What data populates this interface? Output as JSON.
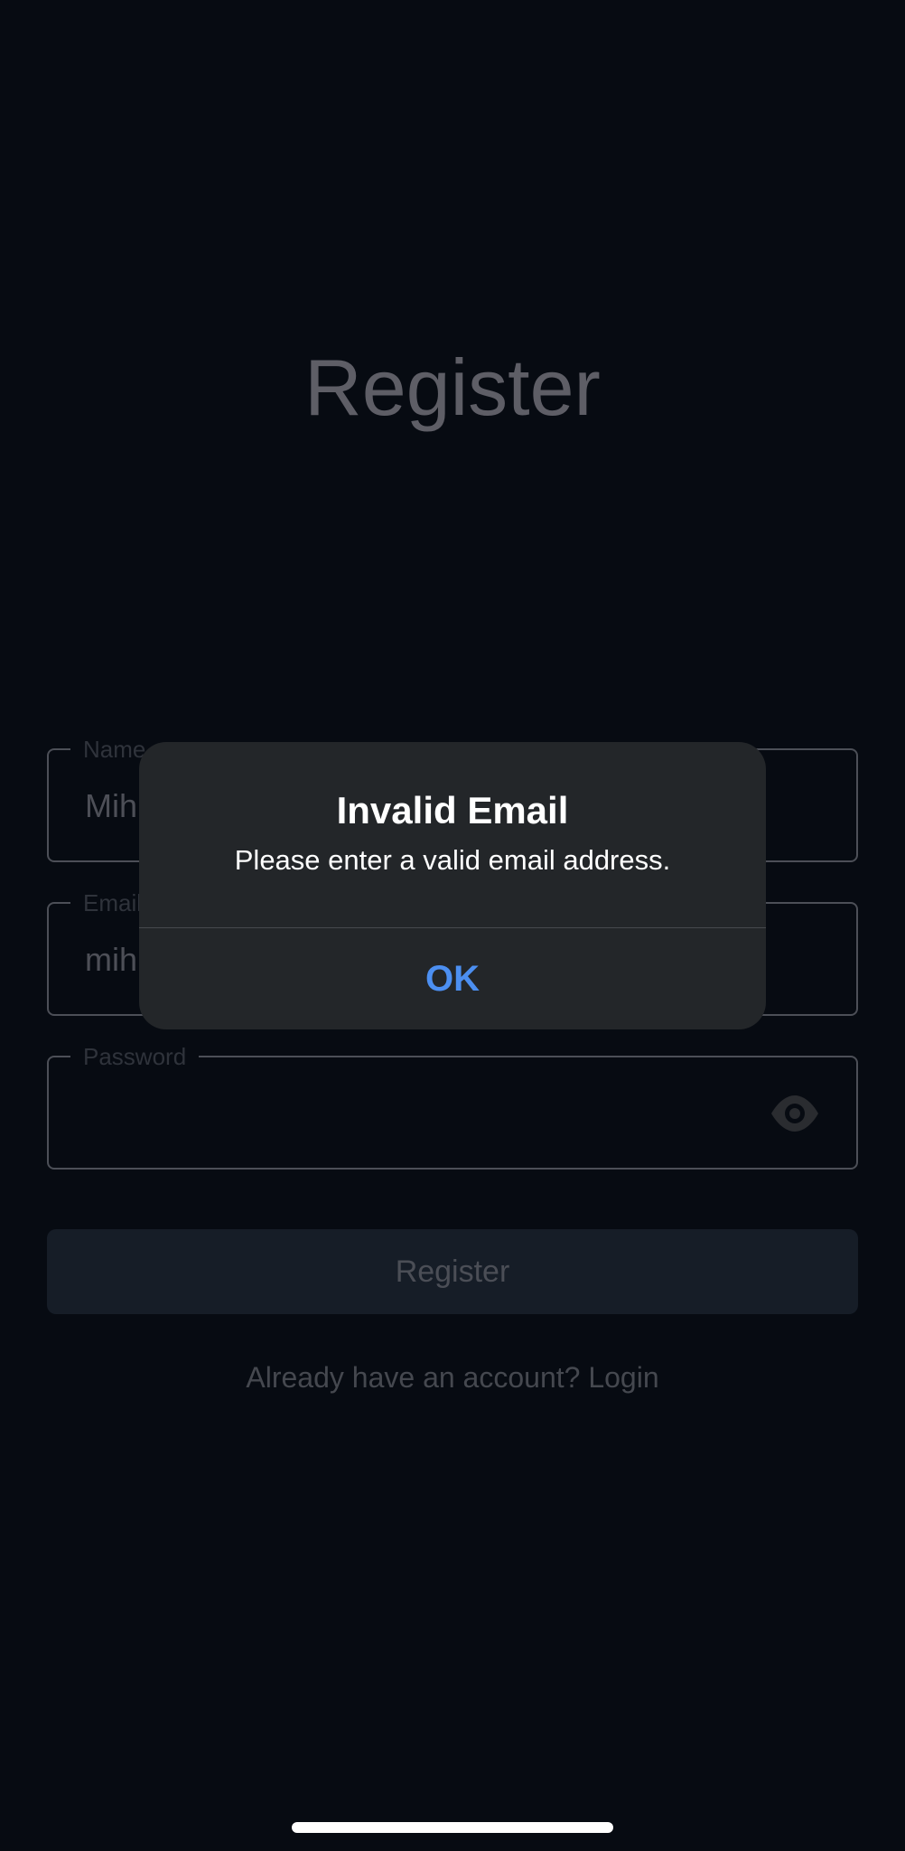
{
  "screen": {
    "title": "Register"
  },
  "form": {
    "name": {
      "label": "Name",
      "value": "Mih"
    },
    "email": {
      "label": "Email",
      "value": "mih"
    },
    "password": {
      "label": "Password",
      "value": "",
      "toggle_icon": "eye-icon"
    },
    "submit_label": "Register",
    "login_prompt": "Already have an account? Login"
  },
  "alert": {
    "title": "Invalid Email",
    "message": "Please enter a valid email address.",
    "ok_label": "OK",
    "accent": "#4c8ff1"
  }
}
